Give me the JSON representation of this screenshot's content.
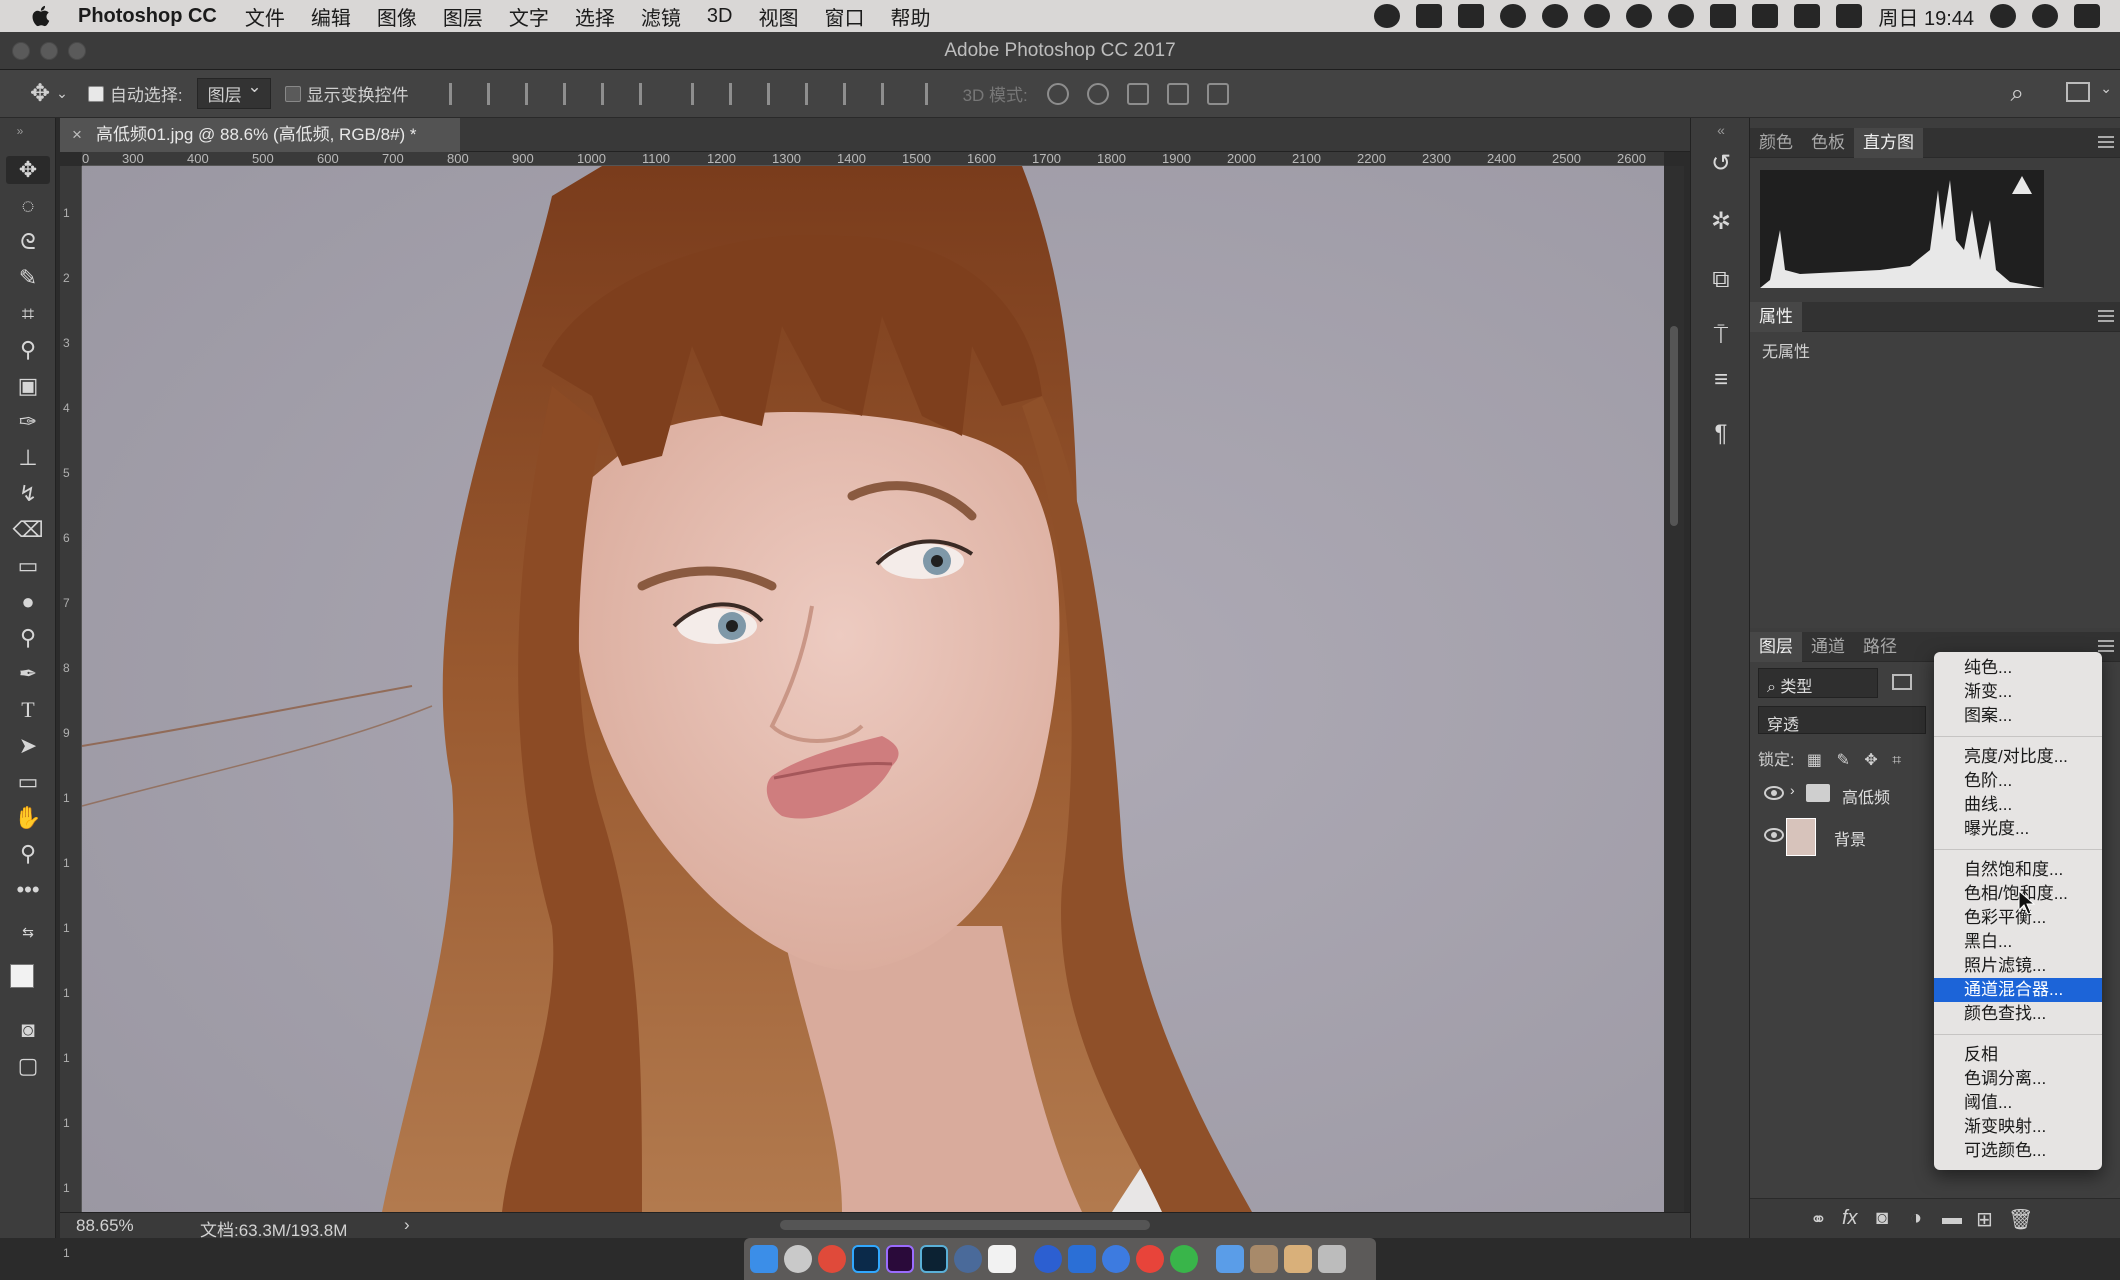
{
  "menubar": {
    "app_name": "Photoshop CC",
    "items": [
      "文件",
      "编辑",
      "图像",
      "图层",
      "文字",
      "选择",
      "滤镜",
      "3D",
      "视图",
      "窗口",
      "帮助"
    ],
    "clock": "周日 19:44"
  },
  "window": {
    "title": "Adobe Photoshop CC 2017"
  },
  "options_bar": {
    "auto_select_label": "自动选择:",
    "auto_select_value": "图层",
    "show_transform_label": "显示变换控件",
    "mode_3d_label": "3D 模式:"
  },
  "document": {
    "tab_title": "高低频01.jpg @ 88.6% (高低频, RGB/8#) *",
    "zoom": "88.65%",
    "doc_size": "文档:63.3M/193.8M",
    "status_arrow": "›"
  },
  "ruler": {
    "h_ticks": [
      "0",
      "300",
      "400",
      "500",
      "600",
      "700",
      "800",
      "900",
      "1000",
      "1100",
      "1200",
      "1300",
      "1400",
      "1500",
      "1600",
      "1700",
      "1800",
      "1900",
      "2000",
      "2100",
      "2200",
      "2300",
      "2400",
      "2500",
      "2600"
    ],
    "v_ticks": [
      "1",
      "2",
      "3",
      "4",
      "5",
      "6",
      "7",
      "8",
      "9",
      "1",
      "1",
      "1",
      "1",
      "1",
      "1",
      "1",
      "1"
    ]
  },
  "panels": {
    "top_tabs": [
      "颜色",
      "色板",
      "直方图"
    ],
    "active_top_tab": "直方图",
    "properties_tab": "属性",
    "properties_empty": "无属性",
    "layer_tabs": [
      "图层",
      "通道",
      "路径"
    ],
    "filter_kind": "类型",
    "blend_mode": "穿透",
    "lock_label": "锁定:",
    "layers": [
      {
        "name": "高低频",
        "kind": "group",
        "visible": true
      },
      {
        "name": "背景",
        "kind": "image",
        "visible": true
      }
    ],
    "bottom_icons": [
      "link-icon",
      "fx-icon",
      "mask-icon",
      "adjustment-icon",
      "folder-icon",
      "new-layer-icon",
      "trash-icon"
    ]
  },
  "adjust_menu": {
    "groups": [
      [
        "纯色...",
        "渐变...",
        "图案..."
      ],
      [
        "亮度/对比度...",
        "色阶...",
        "曲线...",
        "曝光度..."
      ],
      [
        "自然饱和度...",
        "色相/饱和度...",
        "色彩平衡...",
        "黑白...",
        "照片滤镜...",
        "通道混合器...",
        "颜色查找..."
      ],
      [
        "反相",
        "色调分离...",
        "阈值...",
        "渐变映射...",
        "可选颜色..."
      ]
    ],
    "highlighted": "通道混合器..."
  },
  "colors": {
    "accent": "#1c64d8",
    "canvas_bg": "#a6a2ad",
    "hair": "#8b4a25",
    "skin": "#e3b9ad"
  }
}
